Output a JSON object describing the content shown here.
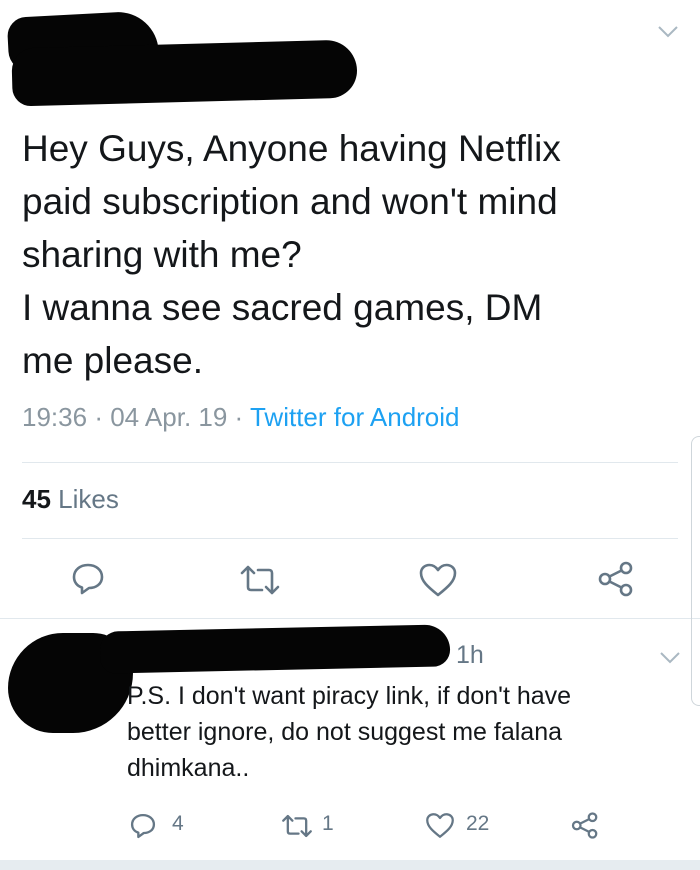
{
  "tweet": {
    "text_lines": [
      "Hey Guys, Anyone having Netflix",
      "paid subscription and won't mind",
      "sharing with me?",
      "I wanna see sacred games, DM",
      "me please."
    ],
    "time": "19:36",
    "date": "04 Apr. 19",
    "source": "Twitter for Android",
    "likes_count": "45",
    "likes_label": "Likes"
  },
  "reply": {
    "time": "1h",
    "text_lines": [
      "P.S. I don't want piracy link, if don't have",
      "better ignore, do not suggest me falana",
      "dhimkana.."
    ],
    "reply_count": "4",
    "retweet_count": "1",
    "like_count": "22"
  },
  "colors": {
    "accent": "#1da1f2",
    "icon": "#657786",
    "text": "#14171a",
    "divider": "#e1e8ed"
  },
  "icons": [
    "chevron-down-icon",
    "reply-icon",
    "retweet-icon",
    "like-icon",
    "share-icon"
  ]
}
